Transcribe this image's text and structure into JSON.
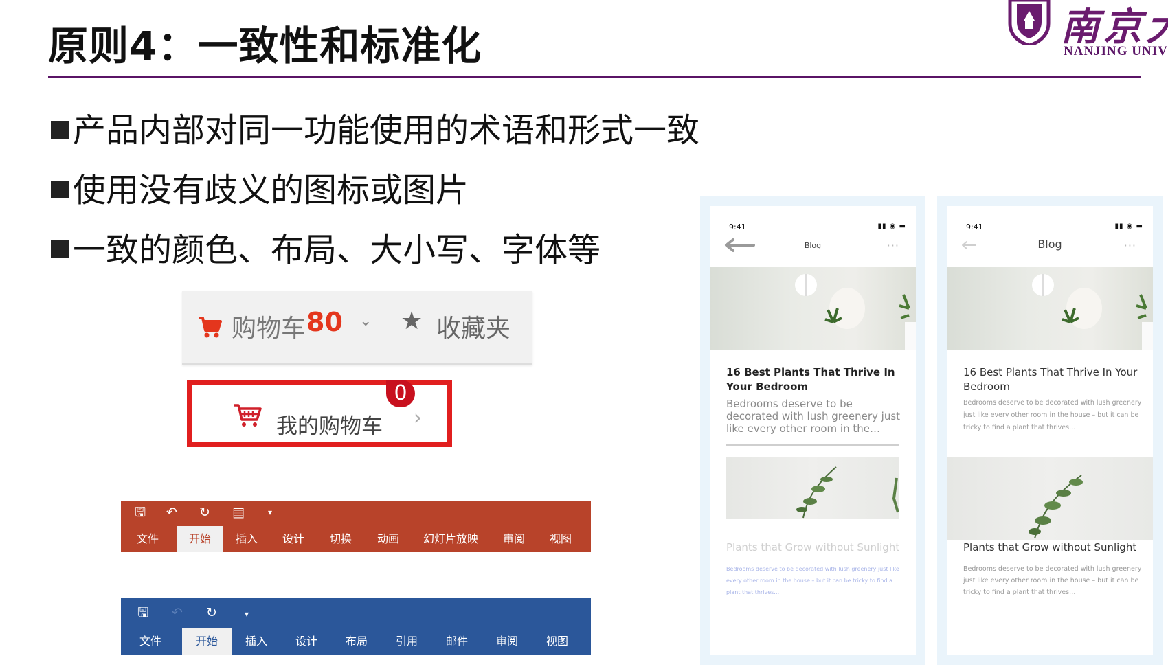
{
  "slide": {
    "title": "原则4：一致性和标准化",
    "logo": {
      "script": "南京大",
      "english": "NANJING UNIV"
    },
    "bullets": [
      "产品内部对同一功能使用的术语和形式一致",
      "使用没有歧义的图标或图片",
      "一致的颜色、布局、大小写、字体等"
    ]
  },
  "cart_bar": {
    "label": "购物车",
    "count": "80",
    "favorites": "收藏夹",
    "icons": [
      "cart-icon",
      "chevron-down-icon",
      "star-icon"
    ]
  },
  "my_cart": {
    "label": "我的购物车",
    "badge": "0",
    "arrow": "›",
    "icons": [
      "cart-icon",
      "chevron-right-icon"
    ]
  },
  "ppt_ribbon": {
    "color": "#b8432a",
    "quick_access": [
      "save-icon",
      "undo-icon",
      "redo-icon",
      "present-icon",
      "customize-icon"
    ],
    "tabs": [
      "文件",
      "开始",
      "插入",
      "设计",
      "切换",
      "动画",
      "幻灯片放映",
      "审阅",
      "视图"
    ],
    "active_tab": "开始"
  },
  "word_ribbon": {
    "color": "#2b579a",
    "quick_access": [
      "save-icon",
      "undo-icon",
      "redo-icon",
      "customize-icon"
    ],
    "tabs": [
      "文件",
      "开始",
      "插入",
      "设计",
      "布局",
      "引用",
      "邮件",
      "审阅",
      "视图"
    ],
    "active_tab": "开始"
  },
  "phones": [
    {
      "time": "9:41",
      "nav_title": "Blog",
      "post1_title": "16 Best Plants That Thrive In Your Bedroom",
      "post1_excerpt": "Bedrooms deserve to be decorated with lush greenery just like every other room in the…",
      "post2_title": "Plants that Grow without Sunlight",
      "post2_excerpt": "Bedrooms deserve to be decorated with lush greenery just like every other room in the house – but it can be tricky to find a plant that thrives…"
    },
    {
      "time": "9:41",
      "nav_title": "Blog",
      "post1_title": "16 Best Plants That Thrive In Your Bedroom",
      "post1_excerpt": "Bedrooms deserve to be decorated with lush greenery just like every other room in the house – but it can be tricky to find a plant that thrives…",
      "post2_title": "Plants that Grow without Sunlight",
      "post2_excerpt": "Bedrooms deserve to be decorated with lush greenery just like every other room in the house – but it can be tricky to find a plant that thrives…"
    }
  ]
}
